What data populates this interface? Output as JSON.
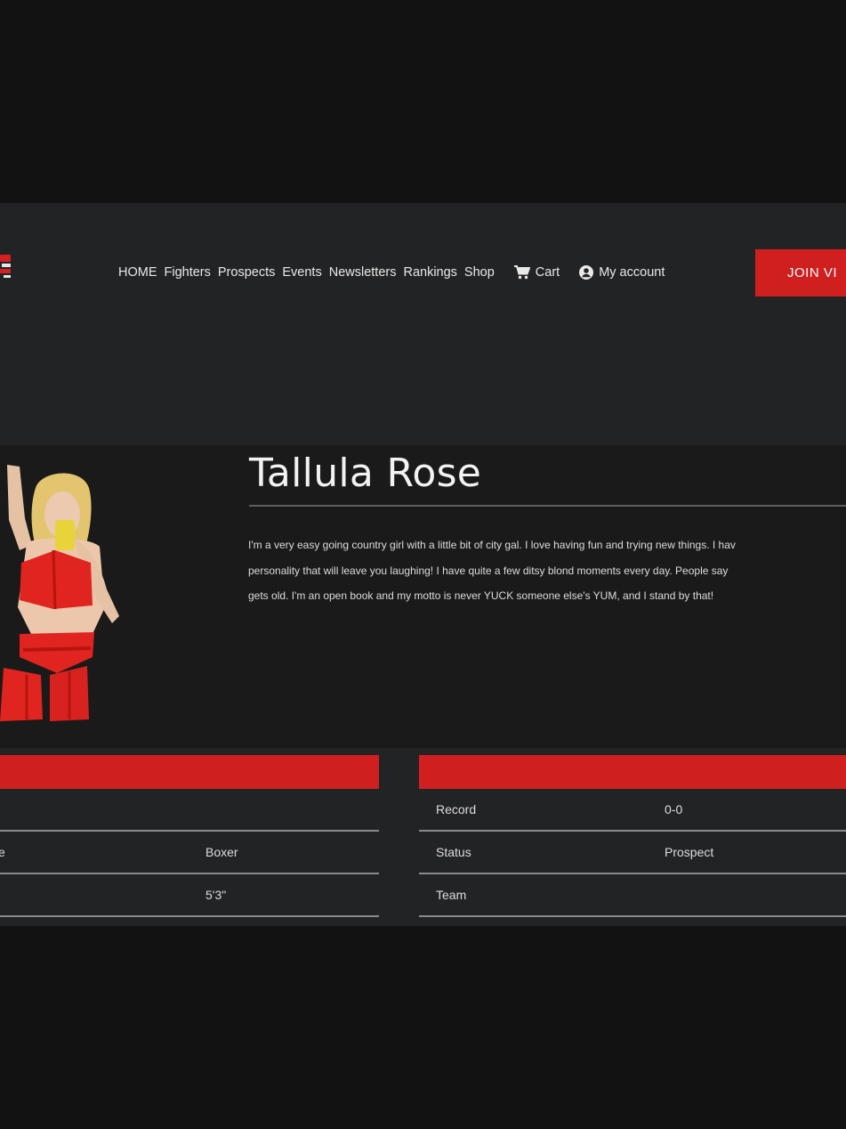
{
  "header": {
    "nav": [
      "HOME",
      "Fighters",
      "Prospects",
      "Events",
      "Newsletters",
      "Rankings",
      "Shop"
    ],
    "cart_label": "Cart",
    "account_label": "My account",
    "join_label": "JOIN VI"
  },
  "profile": {
    "name": "Tallula Rose",
    "bio": [
      "I'm a very easy going country girl with a little bit of city gal. I love having fun and trying new things. I hav",
      "personality that will leave you laughing! I have quite a few ditsy blond moments every day. People say",
      "gets old. I'm an open book and my motto is never YUCK someone else's YUM, and I stand by that!"
    ]
  },
  "stats": {
    "left": [
      {
        "label": "",
        "value": ""
      },
      {
        "label": "e",
        "value": "Boxer"
      },
      {
        "label": "",
        "value": "5'3\""
      }
    ],
    "right": [
      {
        "label": "Record",
        "value": "0-0"
      },
      {
        "label": "Status",
        "value": "Prospect"
      },
      {
        "label": "Team",
        "value": ""
      }
    ]
  },
  "colors": {
    "accent": "#d01f1f",
    "page_bg": "#222325",
    "profile_bg": "#1a1a1a",
    "outer_bg": "#121212"
  },
  "icons": [
    "cart-icon",
    "account-icon"
  ]
}
